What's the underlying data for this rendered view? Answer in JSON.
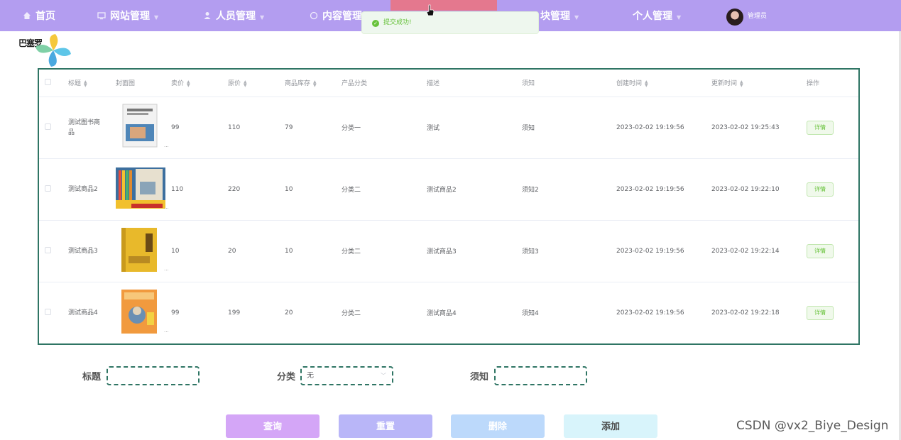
{
  "nav": {
    "items": [
      {
        "label": "首页",
        "icon": "home-icon"
      },
      {
        "label": "网站管理",
        "icon": "monitor-icon"
      },
      {
        "label": "人员管理",
        "icon": "user-icon"
      },
      {
        "label": "内容管理",
        "icon": "content-icon"
      },
      {
        "label": "块管理",
        "icon": "grid-icon"
      },
      {
        "label": "个人管理",
        "icon": "person-icon"
      }
    ],
    "username": "管理员"
  },
  "toast": {
    "message": "提交成功!",
    "icon": "success-check-icon",
    "color": "#67c23a"
  },
  "logo": {
    "text": "巴塞罗"
  },
  "table": {
    "columns": {
      "title": "标题",
      "cover": "封面图",
      "price": "卖价",
      "orig_price": "原价",
      "stock": "商品库存",
      "category": "产品分类",
      "desc": "描述",
      "notice": "须知",
      "created": "创建时间",
      "updated": "更新时间",
      "ops": "操作"
    },
    "rows": [
      {
        "title": "测试图书商品",
        "price": "99",
        "orig_price": "110",
        "stock": "79",
        "category": "分类一",
        "desc": "测试",
        "notice": "须知",
        "created": "2023-02-02 19:19:56",
        "updated": "2023-02-02 19:25:43",
        "action": "详情",
        "cover_ellipsis": "..."
      },
      {
        "title": "测试商品2",
        "price": "110",
        "orig_price": "220",
        "stock": "10",
        "category": "分类二",
        "desc": "测试商品2",
        "notice": "须知2",
        "created": "2023-02-02 19:19:56",
        "updated": "2023-02-02 19:22:10",
        "action": "详情",
        "cover_ellipsis": "..."
      },
      {
        "title": "测试商品3",
        "price": "10",
        "orig_price": "20",
        "stock": "10",
        "category": "分类二",
        "desc": "测试商品3",
        "notice": "须知3",
        "created": "2023-02-02 19:19:56",
        "updated": "2023-02-02 19:22:14",
        "action": "详情",
        "cover_ellipsis": "..."
      },
      {
        "title": "测试商品4",
        "price": "99",
        "orig_price": "199",
        "stock": "20",
        "category": "分类二",
        "desc": "测试商品4",
        "notice": "须知4",
        "created": "2023-02-02 19:19:56",
        "updated": "2023-02-02 19:22:18",
        "action": "详情",
        "cover_ellipsis": "..."
      }
    ]
  },
  "search": {
    "title_label": "标题",
    "title_value": "",
    "category_label": "分类",
    "category_value": "无",
    "notice_label": "须知",
    "notice_value": ""
  },
  "actions": {
    "query": "查询",
    "reset": "重置",
    "delete": "删除",
    "add": "添加"
  },
  "watermark": "CSDN @vx2_Biye_Design",
  "colors": {
    "topbar": "#b39df0",
    "table_border": "#2f7564",
    "query_btn": "#d4a6f7",
    "reset_btn": "#b9b6f8",
    "delete_btn": "#bcd9fb",
    "add_btn": "#d8f4fb"
  }
}
